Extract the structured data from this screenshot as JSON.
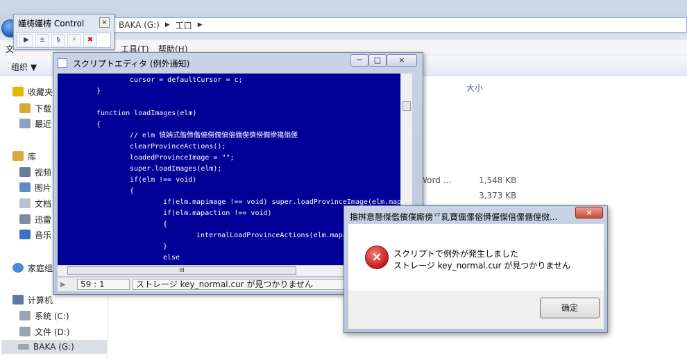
{
  "explorer": {
    "address": {
      "drive": "BAKA (G:)",
      "folder": "工口"
    },
    "menu": {
      "file": "文",
      "tools": "工具(T)",
      "help": "帮助(H)"
    },
    "organize": "组织 ▼",
    "nav": {
      "favorites": "收藏夹",
      "downloads": "下载",
      "recent": "最近",
      "library": "库",
      "videos": "视频",
      "pictures": "图片",
      "documents": "文档",
      "thunder": "迅雷",
      "music": "音乐",
      "homegroup": "家庭组",
      "computer": "计算机",
      "drive_c": "系统 (C:)",
      "drive_d": "文件 (D:)",
      "drive_g": "BAKA (G:)"
    },
    "column_size": "大小",
    "file_type": "Word ...",
    "sizes": [
      "1,548 KB",
      "3,373 KB"
    ]
  },
  "control": {
    "title": "嫤梼嫤梼 Control",
    "close": "×",
    "buttons": [
      "▶",
      "±",
      "§",
      "⚡",
      "✖"
    ]
  },
  "editor": {
    "title": "スクリプトエディタ (例外通知)",
    "min": "─",
    "max": "□",
    "close": "×",
    "code_lines": [
      "\t\tcursor = defaultCursor = c;",
      "\t}",
      "",
      "\tfunction loadImages(elm)",
      "\t{",
      "\t\t// elm 偵姌式偺偙偺僥僗僩偵傛偭偰儕僗僩傪擖傟傞",
      "\t\tclearProvinceActions();",
      "\t\tloadedProvinceImage = \"\";",
      "\t\tsuper.loadImages(elm);",
      "\t\tif(elm !== void)",
      "\t\t{",
      "\t\t\tif(elm.mapimage !== void) super.loadProvinceImage(elm.mapim",
      "\t\t\tif(elm.mapaction !== void)",
      "\t\t\t{",
      "\t\t\t\tinternalLoadProvinceActions(elm.mapac",
      "\t\t\t}",
      "\t\t\telse"
    ],
    "hscroll_thumb": "III",
    "status_pos": "59 : 1",
    "status_msg": "ストレージ key_normal.cur が見つかりません"
  },
  "dialog": {
    "title": "搊桝意懸傑儖儐僕廝傍乊乿寶偑傫傛僢偓傑偣傫偱偟傚...",
    "close": "×",
    "line1": "スクリプトで例外が発生しました",
    "line2": "ストレージ key_normal.cur が見つかりません",
    "ok": "确定",
    "icon": "×"
  }
}
